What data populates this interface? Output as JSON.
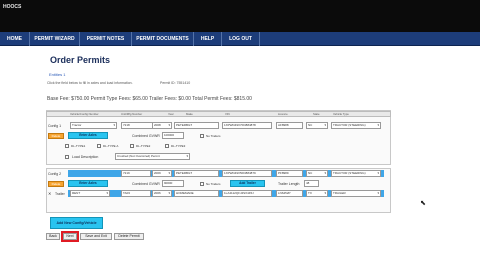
{
  "app": {
    "title": "HOOCS"
  },
  "nav": {
    "items": [
      {
        "label": "HOME"
      },
      {
        "label": "PERMIT WIZARD"
      },
      {
        "label": "PERMIT NOTES"
      },
      {
        "label": "PERMIT DOCUMENTS"
      },
      {
        "label": "HELP"
      },
      {
        "label": "LOG OUT"
      }
    ]
  },
  "page": {
    "title": "Order Permits",
    "subtitle": "Entities 1",
    "description": "Click the field below to fill in axles and load information.",
    "permit_id": "Permit ID: 7551410",
    "fees": "Base Fee: $750.00   Permit Type Fees: $65.00   Trailer Fees: $0.00   Total Permit Fees: $815.00"
  },
  "config1": {
    "header_labels": [
      "Vehicle/Config Number",
      "Unit/Mfg Number",
      "Year",
      "Make",
      "VIN",
      "Licence",
      "State",
      "Vehicle Type"
    ],
    "row_label": "Config 1",
    "fields": [
      "Tractor",
      "7218",
      "2008",
      "PETERBILT",
      "1XPWD49X7FD884878",
      "AF8988",
      "NC",
      "TRACTOR (STEERING)"
    ],
    "delete_label": "Delete",
    "enter_axles": "Enter Axles",
    "combined_weight_label": "Combined GVWR",
    "combined_weight": "100000",
    "no_trailers": "No Trailers",
    "types": [
      "DL-TYPE1",
      "DL-TYPE A",
      "DL-TYPE2",
      "DL-TYPE3"
    ],
    "load_desc_label": "Load Description",
    "load_desc": "Crushed (Not Oversized) Permit"
  },
  "config2": {
    "row_label": "Config 2",
    "fields": [
      "7219",
      "2009",
      "PETERBILT",
      "1XPWD49X5FD884879",
      "PF8989",
      "NC",
      "TRACTOR (STEERING)"
    ],
    "delete_label": "Delete",
    "enter_axles": "Enter Axles",
    "combined_weight_label": "Combined GVWR",
    "combined_weight": "90000",
    "no_trailers": "No Trailers",
    "add_trailer": "Add Trailer",
    "trailer_length_label": "Trailer Length",
    "trailer_length": "48",
    "trailer_label": "Trailer",
    "trailer_fields": [
      "RENT",
      "TA03",
      "2006",
      "HOMEMADE",
      "1LA4112QFJ4SX445J",
      "LN6452P",
      "TX",
      "TRAILER"
    ]
  },
  "actions": {
    "add_config": "Add New Config/Vehicle",
    "back": "Back",
    "next": "Next",
    "save_exit": "Save and Exit",
    "delete_permit": "Delete Permit"
  },
  "colors": {
    "nav_bg": "#1d3d7a",
    "accent_cyan": "#29c4f0",
    "highlight": "#e01b24"
  }
}
